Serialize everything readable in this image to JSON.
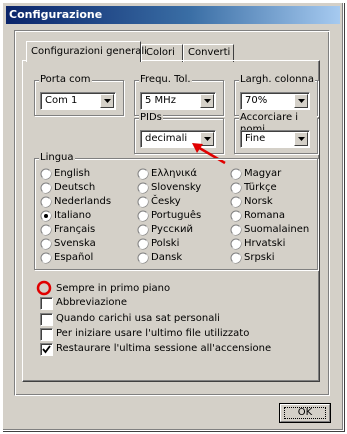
{
  "window": {
    "title": "Configurazione"
  },
  "tabs": [
    {
      "label": "Configurazioni generali"
    },
    {
      "label": "Colori"
    },
    {
      "label": "Converti"
    }
  ],
  "groups": {
    "porta": {
      "label": "Porta com",
      "value": "Com 1"
    },
    "frequ": {
      "label": "Frequ. Tol.",
      "value": "5 MHz"
    },
    "largh": {
      "label": "Largh. colonna",
      "value": "70%"
    },
    "pids": {
      "label": "PIDs",
      "value": "decimali"
    },
    "accorciare": {
      "label": "Accorciare i nomi",
      "value": "Fine"
    }
  },
  "lingua": {
    "label": "Lingua",
    "selected": "Italiano",
    "options": [
      "English",
      "Ελληνικά",
      "Magyar",
      "Deutsch",
      "Slovensky",
      "Türkçe",
      "Nederlands",
      "Česky",
      "Norsk",
      "Italiano",
      "Português",
      "Romana",
      "Français",
      "Русский",
      "Suomalainen",
      "Svenska",
      "Polski",
      "Hrvatski",
      "Español",
      "Dansk",
      "Srpski"
    ]
  },
  "options": {
    "primo_piano": {
      "label": "Sempre in primo piano",
      "checked": false
    },
    "abbreviazione": {
      "label": "Abbreviazione",
      "checked": false
    },
    "carichi": {
      "label": "Quando carichi usa sat personali",
      "checked": false
    },
    "ultimo_file": {
      "label": "Per iniziare usare l'ultimo file utilizzato",
      "checked": false
    },
    "restaurare": {
      "label": "Restaurare l'ultima sessione all'accensione",
      "checked": true
    }
  },
  "buttons": {
    "ok": "OK"
  },
  "annotations": {
    "arrow_color": "#e00000",
    "circle_color": "#e00000"
  }
}
